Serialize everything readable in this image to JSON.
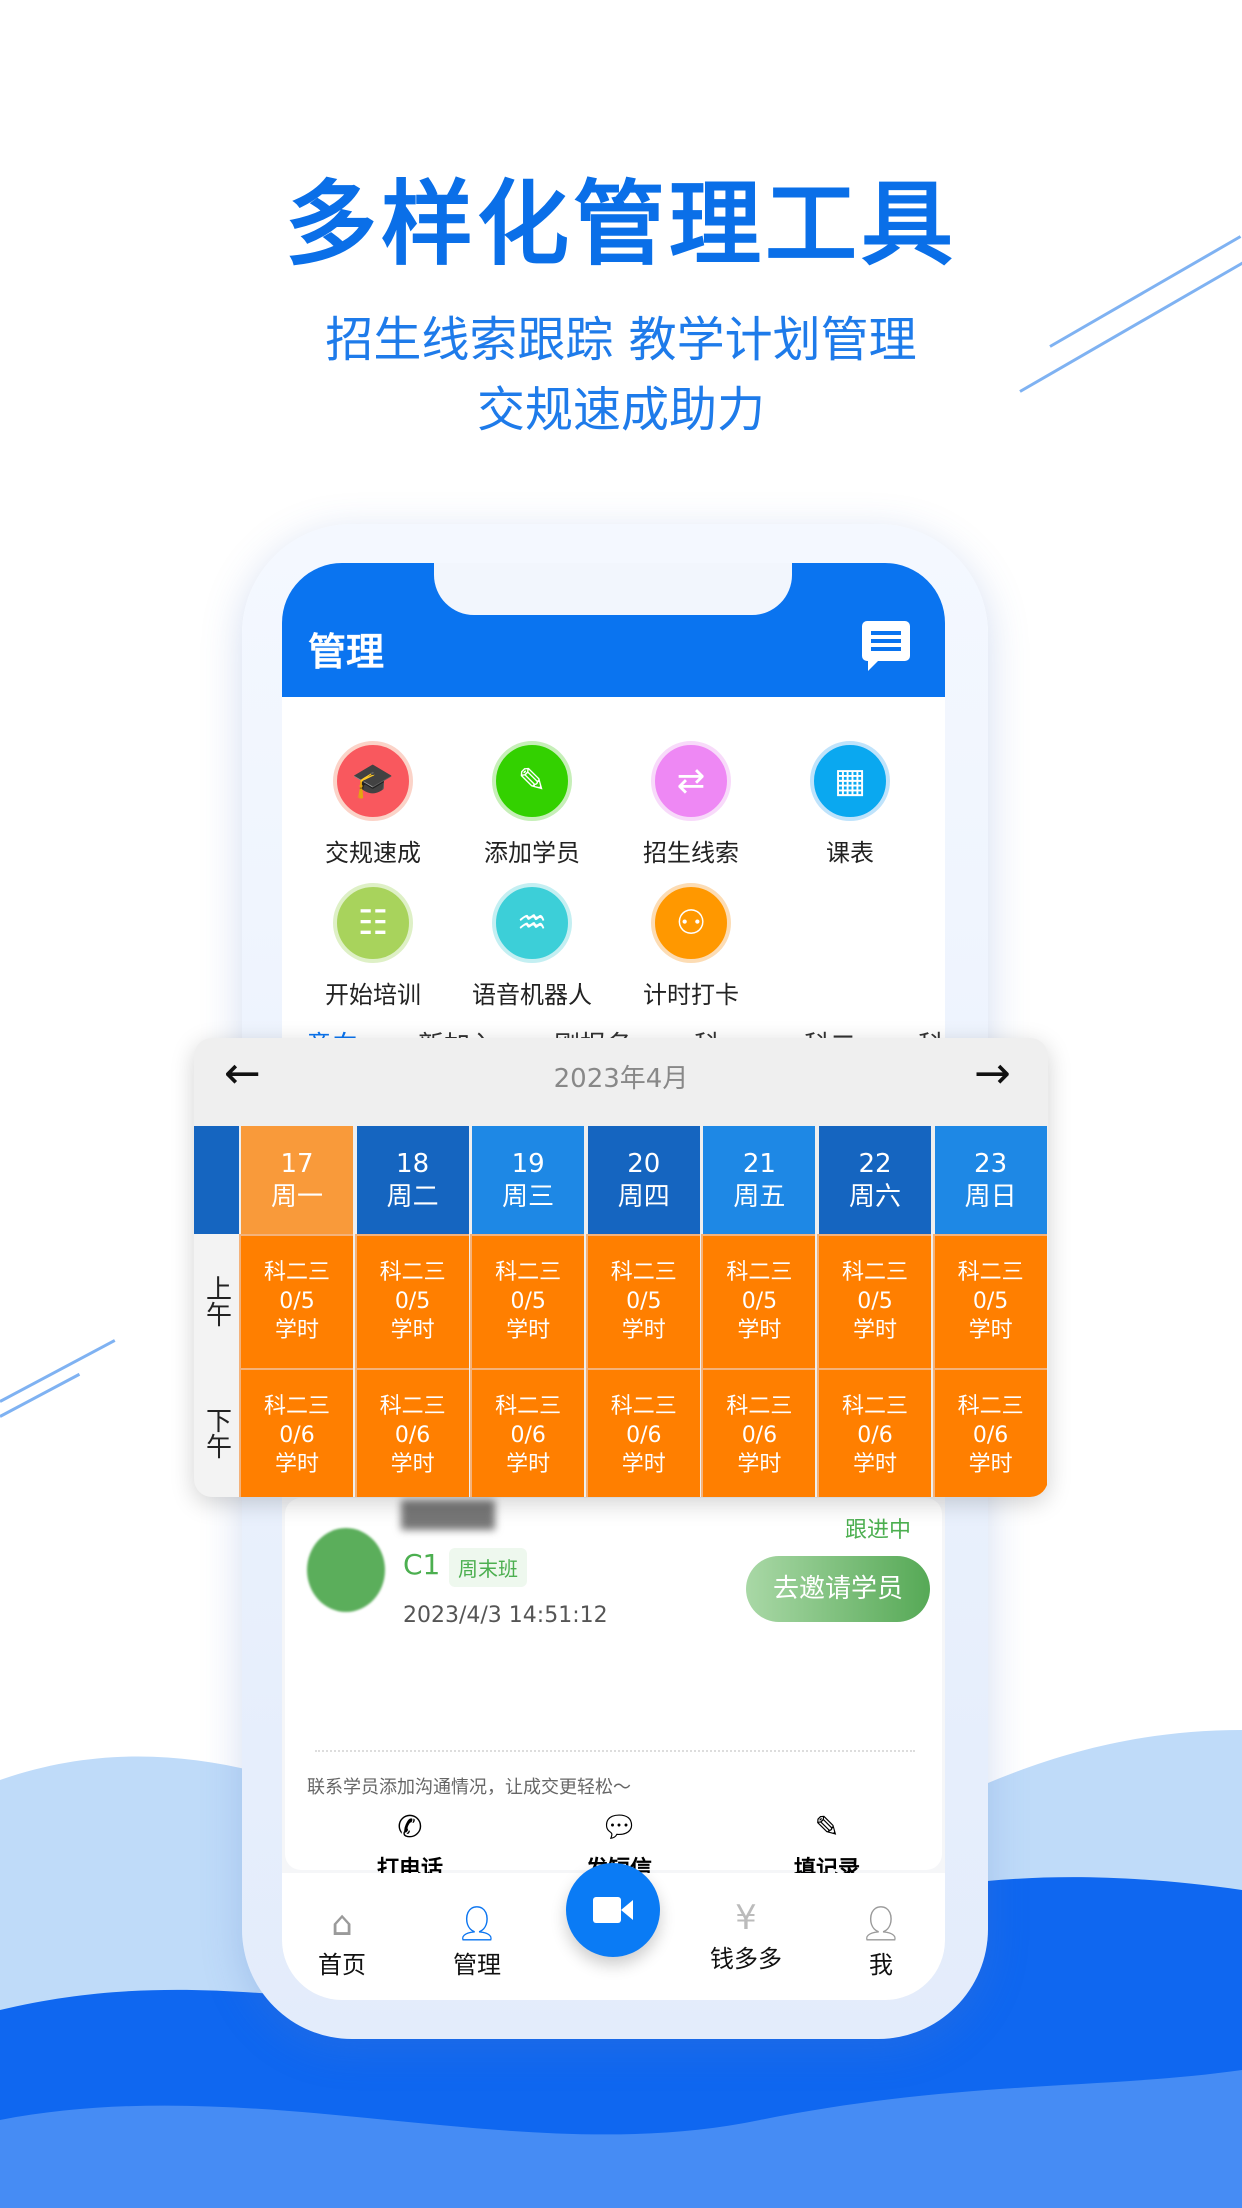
{
  "promo": {
    "title": "多样化管理工具",
    "subtitle_line1": "招生线索跟踪 教学计划管理",
    "subtitle_line2": "交规速成助力"
  },
  "header": {
    "title": "管理",
    "icon": "message-icon"
  },
  "grid": [
    {
      "label": "交规速成",
      "color": "#F9585E",
      "icon": "graduation-cap-icon"
    },
    {
      "label": "添加学员",
      "color": "#33D100",
      "icon": "pen-icon"
    },
    {
      "label": "招生线索",
      "color": "#EE88F4",
      "icon": "flow-icon"
    },
    {
      "label": "课表",
      "color": "#0AA8F0",
      "icon": "calendar-icon"
    },
    {
      "label": "开始培训",
      "color": "#A8D35C",
      "icon": "trainer-icon"
    },
    {
      "label": "语音机器人",
      "color": "#3CCFD8",
      "icon": "robot-icon"
    },
    {
      "label": "计时打卡",
      "color": "#FF9800",
      "icon": "student-car-icon"
    }
  ],
  "tabs": [
    "意向",
    "新加入",
    "刚报名",
    "科一",
    "科二",
    "科三"
  ],
  "calendar": {
    "month": "2023年4月",
    "am_label": "上午",
    "pm_label": "下午",
    "days": [
      {
        "date": "17",
        "weekday": "周一",
        "color": "#F99A3A"
      },
      {
        "date": "18",
        "weekday": "周二",
        "color": "#1565C0"
      },
      {
        "date": "19",
        "weekday": "周三",
        "color": "#1E88E5"
      },
      {
        "date": "20",
        "weekday": "周四",
        "color": "#1565C0"
      },
      {
        "date": "21",
        "weekday": "周五",
        "color": "#1E88E5"
      },
      {
        "date": "22",
        "weekday": "周六",
        "color": "#1565C0"
      },
      {
        "date": "23",
        "weekday": "周日",
        "color": "#1E88E5"
      }
    ],
    "am": {
      "subject": "科二三",
      "count": "0/5",
      "unit": "学时"
    },
    "pm": {
      "subject": "科二三",
      "count": "0/6",
      "unit": "学时"
    }
  },
  "card": {
    "license": "C1",
    "class_tag": "周末班",
    "time": "2023/4/3 14:51:12",
    "status": "跟进中",
    "invite_label": "去邀请学员",
    "hint": "联系学员添加沟通情况，让成交更轻松～",
    "actions": [
      {
        "label": "打电话",
        "icon": "phone-icon"
      },
      {
        "label": "发短信",
        "icon": "sms-icon"
      },
      {
        "label": "填记录",
        "icon": "edit-icon"
      }
    ]
  },
  "nav": [
    {
      "label": "首页",
      "icon": "home-icon"
    },
    {
      "label": "管理",
      "icon": "manage-icon",
      "active": true
    },
    {
      "label": "",
      "icon": "video-camera-icon"
    },
    {
      "label": "钱多多",
      "icon": "money-bag-icon"
    },
    {
      "label": "我",
      "icon": "user-icon"
    }
  ]
}
